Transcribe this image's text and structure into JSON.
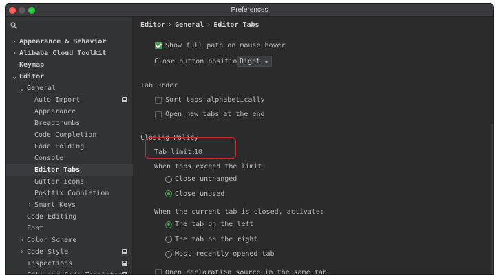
{
  "window": {
    "title": "Preferences"
  },
  "colors": {
    "accent": "#499c54",
    "highlight_border": "#c12c2c",
    "background": "#2b2b2b",
    "sidebar": "#313335"
  },
  "sidebar": {
    "search_icon": "search-icon",
    "items": [
      {
        "label": "Appearance & Behavior",
        "arrow": "›",
        "bold": true
      },
      {
        "label": "Alibaba Cloud Toolkit",
        "arrow": "›",
        "bold": true
      },
      {
        "label": "Keymap",
        "arrow": "",
        "bold": true
      },
      {
        "label": "Editor",
        "arrow": "⌄",
        "bold": true
      },
      {
        "label": "General",
        "arrow": "⌄"
      },
      {
        "label": "Auto Import",
        "badge": true
      },
      {
        "label": "Appearance"
      },
      {
        "label": "Breadcrumbs"
      },
      {
        "label": "Code Completion"
      },
      {
        "label": "Code Folding"
      },
      {
        "label": "Console"
      },
      {
        "label": "Editor Tabs",
        "selected": true
      },
      {
        "label": "Gutter Icons"
      },
      {
        "label": "Postfix Completion"
      },
      {
        "label": "Smart Keys",
        "arrow": "›"
      },
      {
        "label": "Code Editing"
      },
      {
        "label": "Font"
      },
      {
        "label": "Color Scheme",
        "arrow": "›"
      },
      {
        "label": "Code Style",
        "arrow": "›",
        "badge": true
      },
      {
        "label": "Inspections",
        "badge": true
      },
      {
        "label": "File and Code Templates",
        "badge": true
      }
    ]
  },
  "breadcrumb": {
    "part1": "Editor",
    "part2": "General",
    "part3": "Editor Tabs",
    "sep": "›"
  },
  "options": {
    "show_full_path": "Show full path on mouse hover",
    "show_full_path_checked": true,
    "close_button_label": "Close button position:",
    "close_button_value": "Right"
  },
  "tab_order": {
    "title": "Tab Order",
    "sort_alpha": "Sort tabs alphabetically",
    "open_at_end": "Open new tabs at the end"
  },
  "closing_policy": {
    "title": "Closing Policy",
    "tab_limit_label": "Tab limit:",
    "tab_limit_value": "10",
    "exceed_label": "When tabs exceed the limit:",
    "close_unchanged": "Close unchanged",
    "close_unused": "Close unused",
    "current_closed_label": "When the current tab is closed, activate:",
    "tab_left": "The tab on the left",
    "tab_right": "The tab on the right",
    "most_recent": "Most recently opened tab",
    "open_declaration": "Open declaration source in the same tab"
  }
}
